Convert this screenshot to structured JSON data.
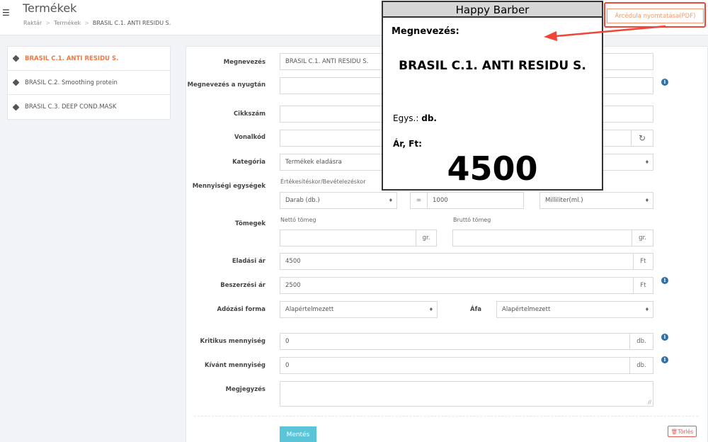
{
  "header": {
    "title": "Termékek",
    "breadcrumb": [
      "Raktár",
      "Termékek",
      "BRASIL C.1. ANTI RESIDU S."
    ],
    "pdf_button": "Árcédula nyomtatása(PDF)"
  },
  "sidebar": {
    "items": [
      {
        "label": "BRASIL C.1. ANTI RESIDU S."
      },
      {
        "label": "BRASIL C.2. Smoothing protein"
      },
      {
        "label": "BRASIL C.3. DEEP COND.MASK"
      }
    ]
  },
  "form": {
    "name": {
      "label": "Megnevezés",
      "value": "BRASIL C.1. ANTI RESIDU S."
    },
    "receipt_name": {
      "label": "Megnevezés a nyugtán",
      "value": ""
    },
    "sku": {
      "label": "Cikkszám",
      "value": ""
    },
    "barcode": {
      "label": "Vonalkód",
      "value": "",
      "refresh_icon": "↻"
    },
    "category": {
      "label": "Kategória",
      "value": "Termékek eladásra"
    },
    "units": {
      "label": "Mennyiségi egységek",
      "sublabel": "Értékesítéskor/Bevételezéskor",
      "unit1": "Darab (db.)",
      "eq": "=",
      "amount": "1000",
      "unit2": "Milliliter(ml.)"
    },
    "weights": {
      "label": "Tömegek",
      "net_label": "Nettó tömeg",
      "gross_label": "Bruttó tömeg",
      "net_value": "",
      "gross_value": "",
      "unit": "gr."
    },
    "sale_price": {
      "label": "Eladási ár",
      "value": "4500",
      "unit": "Ft"
    },
    "purchase_price": {
      "label": "Beszerzési ár",
      "value": "2500",
      "unit": "Ft"
    },
    "tax_form": {
      "label": "Adózási forma",
      "value": "Alapértelmezett"
    },
    "vat": {
      "label": "Áfa",
      "value": "Alapértelmezett"
    },
    "critical_qty": {
      "label": "Kritikus mennyiség",
      "value": "0",
      "unit": "db."
    },
    "desired_qty": {
      "label": "Kívánt mennyiség",
      "value": "0",
      "unit": "db."
    },
    "note": {
      "label": "Megjegyzés",
      "value": ""
    },
    "save_button": "Mentés",
    "delete_button": "Törlés"
  },
  "price_tag": {
    "shop": "Happy Barber",
    "name_label": "Megnevezés:",
    "name": "BRASIL C.1. ANTI RESIDU S.",
    "unit_label": "Egys.:",
    "unit": "db.",
    "price_label": "Ár, Ft:",
    "price": "4500"
  },
  "colors": {
    "accent_orange": "#f0773f",
    "save_button": "#5bc4d9",
    "delete_red": "#e45b5b",
    "annotation_red": "#f04637",
    "info_blue": "#336fa7"
  }
}
